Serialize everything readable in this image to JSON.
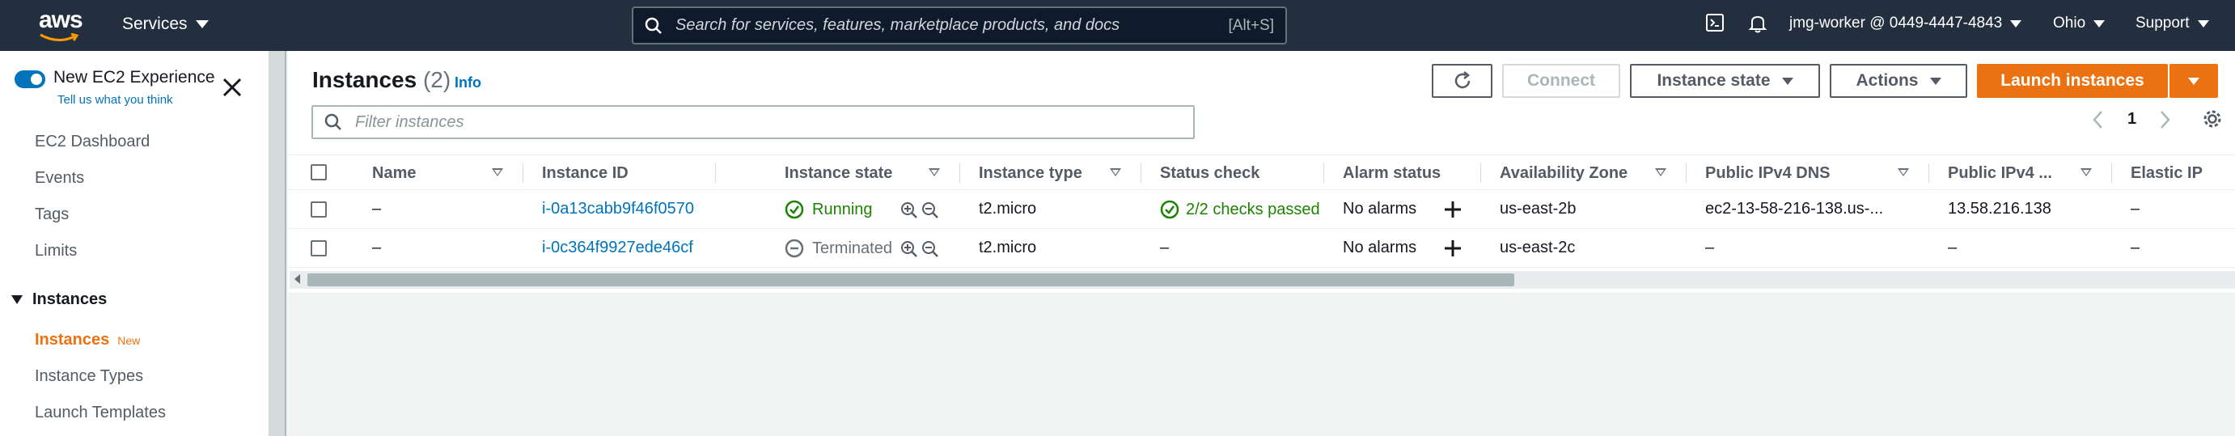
{
  "topnav": {
    "logo": "aws",
    "services": "Services",
    "search_placeholder": "Search for services, features, marketplace products, and docs",
    "search_shortcut": "[Alt+S]",
    "account": "jmg-worker @ 0449-4447-4843",
    "region": "Ohio",
    "support": "Support",
    "icons": [
      "cloudshell-icon",
      "bell-icon"
    ]
  },
  "sidebar": {
    "new_experience": "New EC2 Experience",
    "tell_us": "Tell us what you think",
    "items": [
      "EC2 Dashboard",
      "Events",
      "Tags",
      "Limits"
    ],
    "section": "Instances",
    "section_items": [
      {
        "label": "Instances",
        "badge": "New"
      },
      {
        "label": "Instance Types"
      },
      {
        "label": "Launch Templates"
      }
    ]
  },
  "header": {
    "title": "Instances",
    "count": "(2)",
    "info": "Info",
    "connect": "Connect",
    "instance_state": "Instance state",
    "actions": "Actions",
    "launch": "Launch instances"
  },
  "filter": {
    "placeholder": "Filter instances"
  },
  "pager": {
    "page": "1"
  },
  "table": {
    "columns": [
      "Name",
      "Instance ID",
      "Instance state",
      "Instance type",
      "Status check",
      "Alarm status",
      "Availability Zone",
      "Public IPv4 DNS",
      "Public IPv4 ...",
      "Elastic IP"
    ],
    "rows": [
      {
        "name": "–",
        "id": "i-0a13cabb9f46f0570",
        "state": "Running",
        "type": "t2.micro",
        "status": "2/2 checks passed",
        "alarm": "No alarms",
        "az": "us-east-2b",
        "dns": "ec2-13-58-216-138.us-...",
        "ipv4": "13.58.216.138",
        "eip": "–"
      },
      {
        "name": "–",
        "id": "i-0c364f9927ede46cf",
        "state": "Terminated",
        "type": "t2.micro",
        "status": "–",
        "alarm": "No alarms",
        "az": "us-east-2c",
        "dns": "–",
        "ipv4": "–",
        "eip": "–"
      }
    ]
  },
  "colors": {
    "nav_bg": "#232f3e",
    "accent": "#ec7211",
    "link": "#0073bb",
    "success": "#1d8102"
  }
}
